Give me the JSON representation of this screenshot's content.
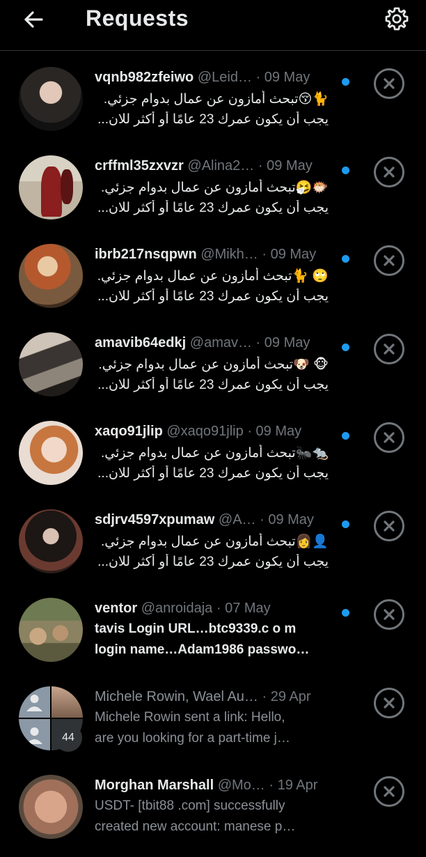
{
  "header": {
    "title": "Requests"
  },
  "rows": [
    {
      "name": "vqnb982zfeiwo",
      "handle": "@Leid…",
      "sep": "·",
      "date": "09 May",
      "line1": "🐈😚تبحث أمازون عن عمال بدوام جزئي.",
      "line2": "يجب أن يكون عمرك 23 عامًا أو أكثر للان...",
      "unread": true
    },
    {
      "name": "crffml35zxvzr",
      "handle": "@Alina2…",
      "sep": "·",
      "date": "09 May",
      "line1": "🐡🤧تبحث أمازون عن عمال بدوام جزئي.",
      "line2": "يجب أن يكون عمرك 23 عامًا أو أكثر للان...",
      "unread": true
    },
    {
      "name": "ibrb217nsqpwn",
      "handle": "@Mikh…",
      "sep": "·",
      "date": "09 May",
      "line1": "🙄 🐈تبحث أمازون عن عمال بدوام جزئي.",
      "line2": "يجب أن يكون عمرك 23 عامًا أو أكثر للان...",
      "unread": true
    },
    {
      "name": "amavib64edkj",
      "handle": "@amav…",
      "sep": "·",
      "date": "09 May",
      "line1": "🐵 🐶تبحث أمازون عن عمال بدوام جزئي.",
      "line2": "يجب أن يكون عمرك 23 عامًا أو أكثر للان...",
      "unread": true
    },
    {
      "name": "xaqo91jlip",
      "handle": "@xaqo91jlip",
      "sep": "·",
      "date": "09 May",
      "line1": "🐀🐜تبحث أمازون عن عمال بدوام جزئي.",
      "line2": "يجب أن يكون عمرك 23 عامًا أو أكثر للان...",
      "unread": true
    },
    {
      "name": "sdjrv4597xpumaw",
      "handle": "@A…",
      "sep": "·",
      "date": "09 May",
      "line1": "👤👩تبحث أمازون عن عمال بدوام جزئي.",
      "line2": "يجب أن يكون عمرك 23 عامًا أو أكثر للان...",
      "unread": true
    },
    {
      "name": "ventor",
      "handle": "@anroidaja",
      "sep": "·",
      "date": "07 May",
      "line1": "tavis Login URL…btc9339.c o m",
      "line2": "login name…Adam1986 passwo…",
      "unread": true
    },
    {
      "name": "Michele Rowin, Wael Au…",
      "handle": "",
      "sep": "·",
      "date": "29 Apr",
      "line1": "Michele Rowin sent a link: Hello,",
      "line2": "are you looking for a part-time j…",
      "unread": false,
      "badge": "44"
    },
    {
      "name": "Morghan Marshall",
      "handle": "@Mo…",
      "sep": "·",
      "date": "19 Apr",
      "line1": "USDT- [tbit88 .com] successfully",
      "line2": "created new account: manese p…",
      "unread": false
    }
  ],
  "icons": {
    "back": "arrow-left-icon",
    "settings": "gear-icon",
    "dismiss": "close-circle-icon",
    "unread": "blue-dot"
  },
  "colors": {
    "background": "#000000",
    "text": "#e7e9ea",
    "secondary": "#71767b",
    "accent": "#1d9bf0"
  }
}
